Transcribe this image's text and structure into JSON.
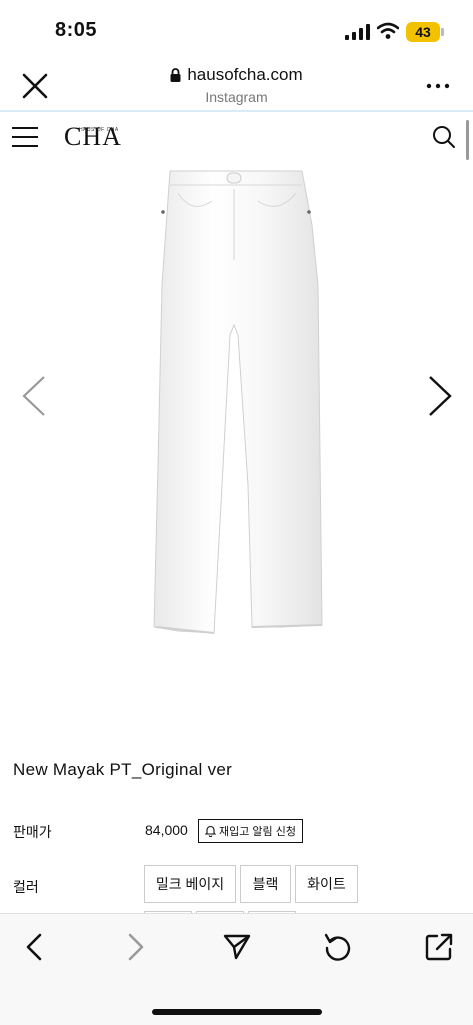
{
  "status": {
    "time": "8:05",
    "battery": "43"
  },
  "browser": {
    "domain": "hausofcha.com",
    "source": "Instagram"
  },
  "site": {
    "logo": "CHA",
    "logo_small": "HAUS OF CHA"
  },
  "product": {
    "title": "New Mayak PT_Original ver",
    "price_label": "판매가",
    "price": "84,000",
    "restock_label": "재입고 알림 신청",
    "color_label": "컬러",
    "colors": [
      "밀크 베이지",
      "블랙",
      "화이트"
    ]
  },
  "icons": {
    "close": "close-icon",
    "lock": "lock-icon",
    "more": "more-icon",
    "menu": "hamburger-icon",
    "search": "search-icon",
    "bell": "bell-icon",
    "back": "chevron-left-icon",
    "forward": "chevron-right-icon",
    "share": "send-icon",
    "reload": "reload-icon",
    "external": "open-external-icon"
  },
  "colors": {
    "accent_line": "#d7ecf6",
    "battery": "#f2c200",
    "bar_bg": "#f8f8f8"
  }
}
